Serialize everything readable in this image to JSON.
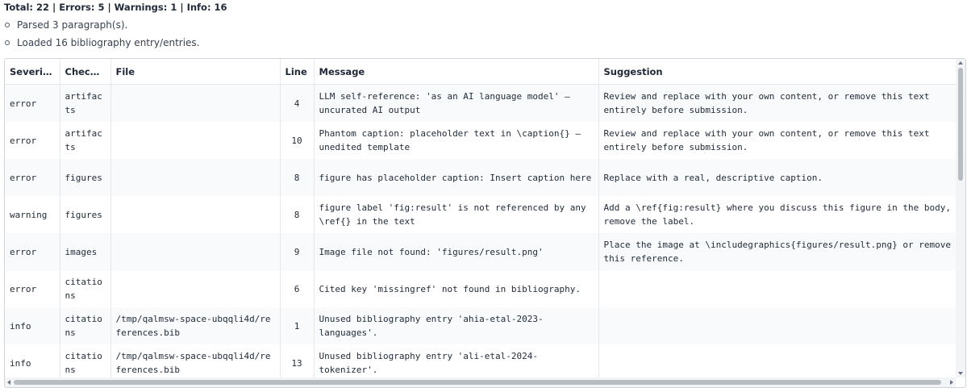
{
  "summary": "Total: 22 | Errors: 5 | Warnings: 1 | Info: 16",
  "log": [
    "Parsed 3 paragraph(s).",
    "Loaded 16 bibliography entry/entries."
  ],
  "table": {
    "headers": [
      "Severi…",
      "Checker",
      "File",
      "Line",
      "Message",
      "Suggestion"
    ],
    "rows": [
      [
        "error",
        "artifacts",
        "",
        "4",
        "LLM self-reference: 'as an AI language model' — uncurated AI output",
        "Review and replace with your own content, or remove this text entirely before submission."
      ],
      [
        "error",
        "artifacts",
        "",
        "10",
        "Phantom caption: placeholder text in \\caption{} — unedited template",
        "Review and replace with your own content, or remove this text entirely before submission."
      ],
      [
        "error",
        "figures",
        "",
        "8",
        "figure has placeholder caption: Insert caption here",
        "Replace with a real, descriptive caption."
      ],
      [
        "warning",
        "figures",
        "",
        "8",
        "figure label 'fig:result' is not referenced by any \\ref{} in the text",
        "Add a \\ref{fig:result} where you discuss this figure in the body, or remove the label."
      ],
      [
        "error",
        "images",
        "",
        "9",
        "Image file not found: 'figures/result.png'",
        "Place the image at \\includegraphics{figures/result.png} or remove this reference."
      ],
      [
        "error",
        "citations",
        "",
        "6",
        "Cited key 'missingref' not found in bibliography.",
        ""
      ],
      [
        "info",
        "citations",
        "/tmp/qalmsw-space-ubqqli4d/references.bib",
        "1",
        "Unused bibliography entry 'ahia-etal-2023-languages'.",
        ""
      ],
      [
        "info",
        "citations",
        "/tmp/qalmsw-space-ubqqli4d/references.bib",
        "13",
        "Unused bibliography entry 'ali-etal-2024-tokenizer'.",
        ""
      ]
    ]
  }
}
